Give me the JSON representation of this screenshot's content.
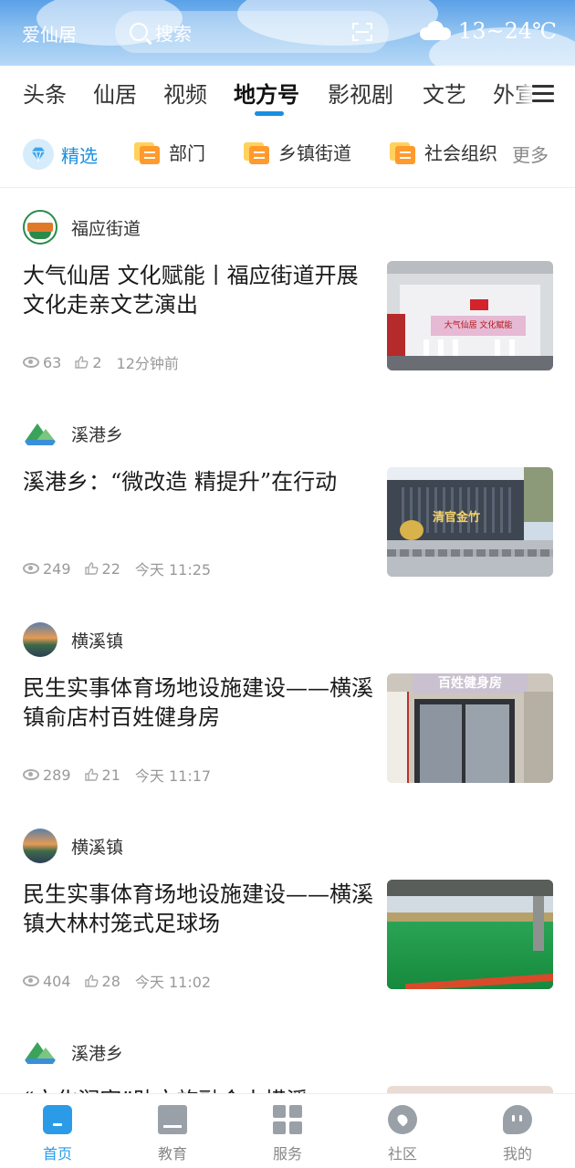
{
  "header": {
    "app_name": "爱仙居",
    "search_placeholder": "搜索",
    "temperature": "13~24℃"
  },
  "tabs": {
    "items": [
      {
        "label": "头条"
      },
      {
        "label": "仙居"
      },
      {
        "label": "视频"
      },
      {
        "label": "地方号"
      },
      {
        "label": "影视剧"
      },
      {
        "label": "文艺"
      },
      {
        "label": "外宣"
      }
    ],
    "active": "地方号"
  },
  "subcats": {
    "items": [
      {
        "label": "精选"
      },
      {
        "label": "部门"
      },
      {
        "label": "乡镇街道"
      },
      {
        "label": "社会组织"
      }
    ],
    "more": "更多"
  },
  "articles": [
    {
      "source": "福应街道",
      "title": "大气仙居 文化赋能丨福应街道开展文化走亲文艺演出",
      "views": "63",
      "likes": "2",
      "time": "12分钟前",
      "banner_text": "大气仙居 文化赋能"
    },
    {
      "source": "溪港乡",
      "title": "溪港乡：“微改造 精提升”在行动",
      "views": "249",
      "likes": "22",
      "time": "今天  11:25",
      "sign_text": "清官金竹"
    },
    {
      "source": "横溪镇",
      "title": "民生实事体育场地设施建设——横溪镇俞店村百姓健身房",
      "views": "289",
      "likes": "21",
      "time": "今天  11:17",
      "sign_text": "百姓健身房"
    },
    {
      "source": "横溪镇",
      "title": "民生实事体育场地设施建设——横溪镇大林村笼式足球场",
      "views": "404",
      "likes": "28",
      "time": "今天  11:02"
    },
    {
      "source": "溪港乡",
      "title": "“文化润家”助文旅融合丨横溪",
      "views": "",
      "likes": "",
      "time": ""
    }
  ],
  "bottom_nav": {
    "items": [
      {
        "label": "首页"
      },
      {
        "label": "教育"
      },
      {
        "label": "服务"
      },
      {
        "label": "社区"
      },
      {
        "label": "我的"
      }
    ],
    "active": "首页"
  },
  "colors": {
    "accent": "#1a8fe0",
    "header_top": "#5aa0e8",
    "nav_active": "#2b9be8"
  }
}
